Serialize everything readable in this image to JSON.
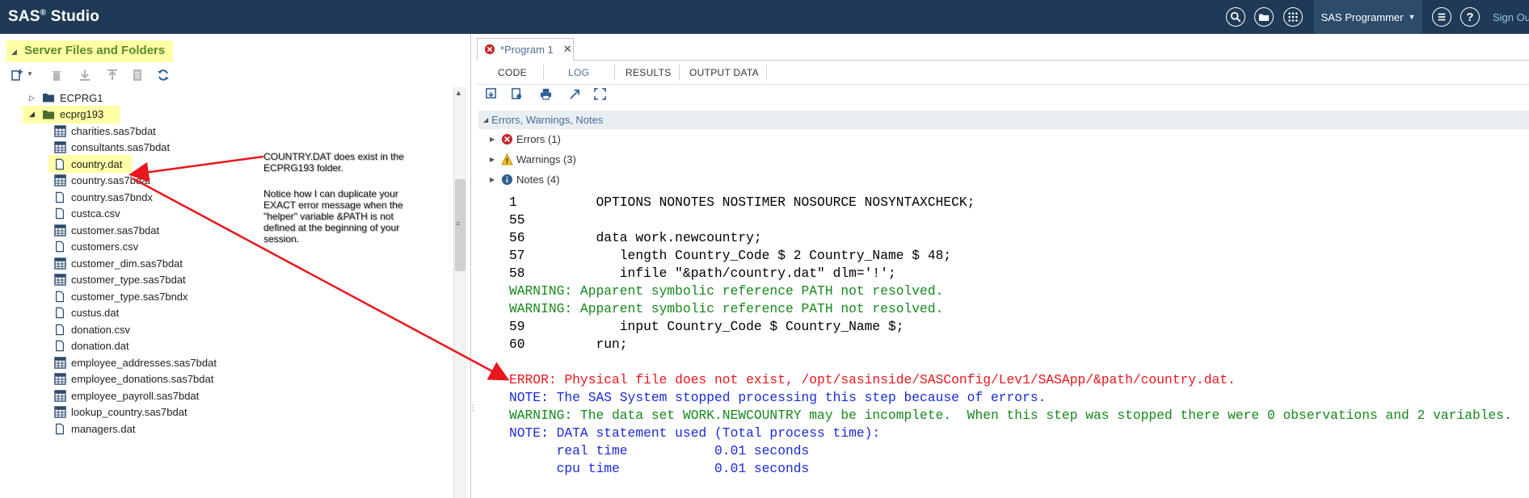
{
  "app": {
    "title": "SAS",
    "title_sup": "®",
    "title_suffix": " Studio",
    "user_menu": "SAS Programmer",
    "sign_out": "Sign Out",
    "help_label": "?"
  },
  "left_panel": {
    "title": "Server Files and Folders",
    "tree": [
      {
        "label": "ECPRG1",
        "type": "folder",
        "expanded": false
      },
      {
        "label": "ecprg193",
        "type": "folder",
        "expanded": true
      },
      {
        "label": "charities.sas7bdat",
        "type": "table"
      },
      {
        "label": "consultants.sas7bdat",
        "type": "table"
      },
      {
        "label": "country.dat",
        "type": "file"
      },
      {
        "label": "country.sas7bdat",
        "type": "table"
      },
      {
        "label": "country.sas7bndx",
        "type": "file"
      },
      {
        "label": "custca.csv",
        "type": "file"
      },
      {
        "label": "customer.sas7bdat",
        "type": "table"
      },
      {
        "label": "customers.csv",
        "type": "file"
      },
      {
        "label": "customer_dim.sas7bdat",
        "type": "table"
      },
      {
        "label": "customer_type.sas7bdat",
        "type": "table"
      },
      {
        "label": "customer_type.sas7bndx",
        "type": "file"
      },
      {
        "label": "custus.dat",
        "type": "file"
      },
      {
        "label": "donation.csv",
        "type": "file"
      },
      {
        "label": "donation.dat",
        "type": "file"
      },
      {
        "label": "employee_addresses.sas7bdat",
        "type": "table"
      },
      {
        "label": "employee_donations.sas7bdat",
        "type": "table"
      },
      {
        "label": "employee_payroll.sas7bdat",
        "type": "table"
      },
      {
        "label": "lookup_country.sas7bdat",
        "type": "table"
      },
      {
        "label": "managers.dat",
        "type": "file"
      }
    ]
  },
  "annotation": {
    "line1a": "COUNTRY.DAT does exist in the",
    "line1b": "ECPRG193 folder.",
    "line2a": "Notice how I can duplicate your",
    "line2b": "EXACT error message when the",
    "line2c": "\"helper\" variable &PATH is not",
    "line2d": "defined at the beginning of your",
    "line2e": "session."
  },
  "editor": {
    "program_tab": "*Program 1",
    "tabs": [
      "CODE",
      "LOG",
      "RESULTS",
      "OUTPUT DATA"
    ],
    "active_tab": "LOG",
    "ewn_title": "Errors, Warnings, Notes",
    "ewn": [
      {
        "label": "Errors (1)",
        "kind": "error"
      },
      {
        "label": "Warnings (3)",
        "kind": "warning"
      },
      {
        "label": "Notes (4)",
        "kind": "note"
      }
    ]
  },
  "log": [
    {
      "kind": "src",
      "text": "1          OPTIONS NONOTES NOSTIMER NOSOURCE NOSYNTAXCHECK;"
    },
    {
      "kind": "src",
      "text": "55"
    },
    {
      "kind": "src",
      "text": "56         data work.newcountry;"
    },
    {
      "kind": "src",
      "text": "57            length Country_Code $ 2 Country_Name $ 48;"
    },
    {
      "kind": "src",
      "text": "58            infile \"&path/country.dat\" dlm='!';"
    },
    {
      "kind": "warn",
      "text": "WARNING: Apparent symbolic reference PATH not resolved."
    },
    {
      "kind": "warn",
      "text": "WARNING: Apparent symbolic reference PATH not resolved."
    },
    {
      "kind": "src",
      "text": "59            input Country_Code $ Country_Name $;"
    },
    {
      "kind": "src",
      "text": "60         run;"
    },
    {
      "kind": "blank",
      "text": " "
    },
    {
      "kind": "err",
      "text": "ERROR: Physical file does not exist, /opt/sasinside/SASConfig/Lev1/SASApp/&path/country.dat."
    },
    {
      "kind": "note",
      "text": "NOTE: The SAS System stopped processing this step because of errors."
    },
    {
      "kind": "warn",
      "text": "WARNING: The data set WORK.NEWCOUNTRY may be incomplete.  When this step was stopped there were 0 observations and 2 variables."
    },
    {
      "kind": "note",
      "text": "NOTE: DATA statement used (Total process time):"
    },
    {
      "kind": "note",
      "text": "      real time           0.01 seconds"
    },
    {
      "kind": "note",
      "text": "      cpu time            0.01 seconds"
    }
  ],
  "colors": {
    "topbar": "#1f3a56",
    "highlight": "#ffffa6",
    "arrow": "#e8171c"
  }
}
